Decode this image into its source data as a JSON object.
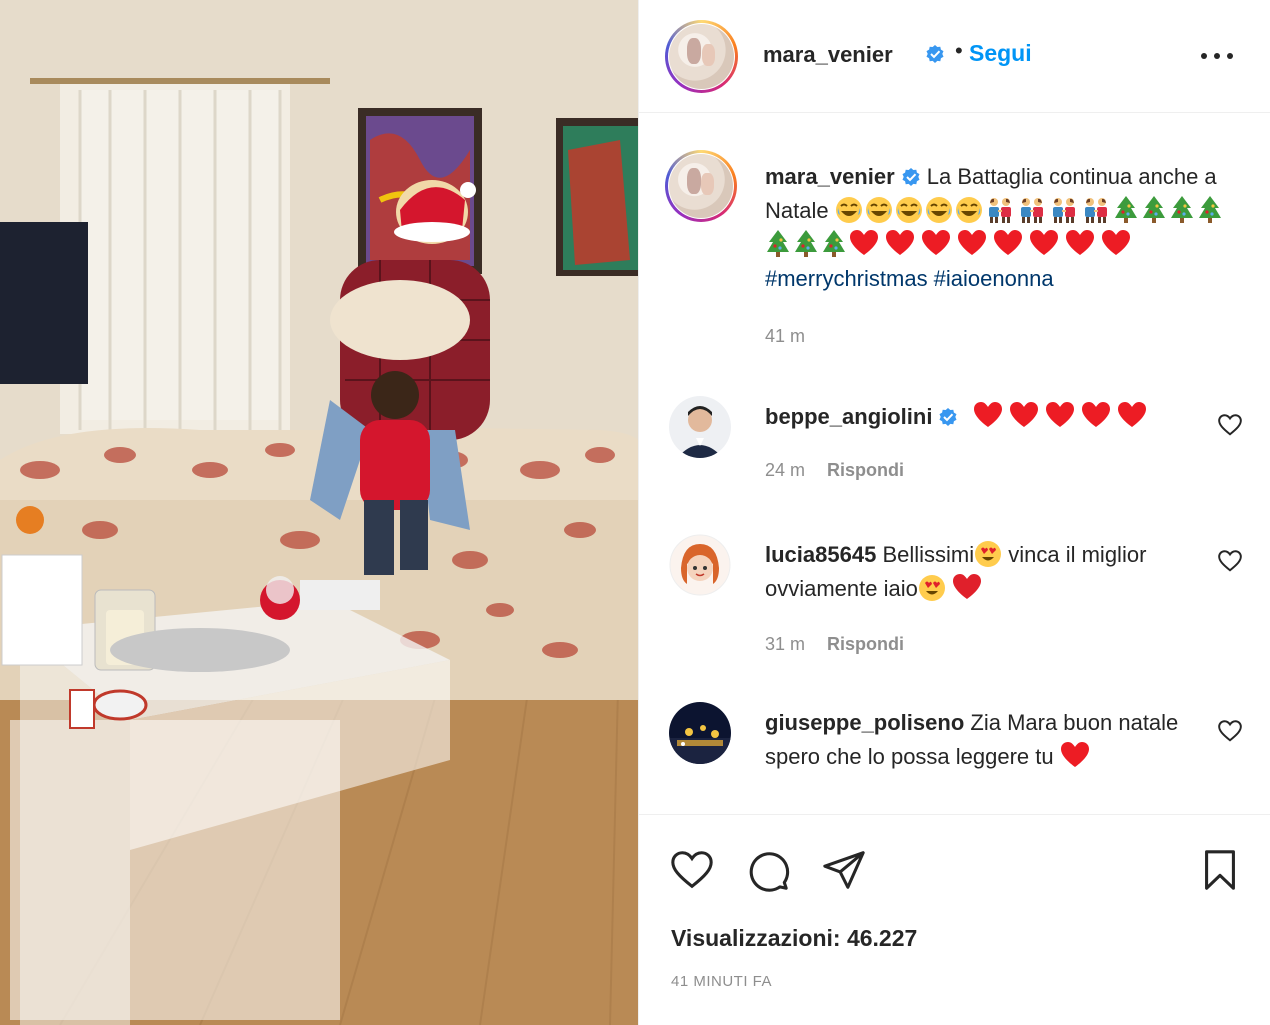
{
  "post": {
    "author": "mara_venier",
    "follow_label": "Segui",
    "separator": "•",
    "verified_icon": "verified-badge-icon",
    "more_icon": "more-options-icon"
  },
  "caption": {
    "username": "mara_venier",
    "text_part1": "La Battaglia continua anche a Natale",
    "hashtags": "#merrychristmas #iaioenonna",
    "emoji_counts": {
      "laughing": 5,
      "kids": 4,
      "trees": 7,
      "hearts": 8
    },
    "time": "41 m"
  },
  "comments": [
    {
      "username": "beppe_angiolini",
      "verified": true,
      "text": "",
      "hearts": 5,
      "time": "24 m",
      "reply_label": "Rispondi"
    },
    {
      "username": "lucia85645",
      "verified": false,
      "text_a": "Bellissimi",
      "text_b": "vinca il miglior ovviamente iaio",
      "time": "31 m",
      "reply_label": "Rispondi"
    },
    {
      "username": "giuseppe_poliseno",
      "verified": false,
      "text": "Zia Mara buon natale spero che lo possa leggere tu",
      "hearts": 1
    }
  ],
  "actions": {
    "like_icon": "heart-outline-icon",
    "comment_icon": "comment-bubble-icon",
    "share_icon": "paper-plane-icon",
    "save_icon": "bookmark-icon"
  },
  "stats": {
    "views_label": "Visualizzazioni: 46.227",
    "posted_ago": "41 MINUTI FA"
  },
  "colors": {
    "accent": "#0095f6",
    "hashtag": "#00376b",
    "muted": "#8e8e8e",
    "text": "#262626",
    "heart": "#ed1c24"
  }
}
